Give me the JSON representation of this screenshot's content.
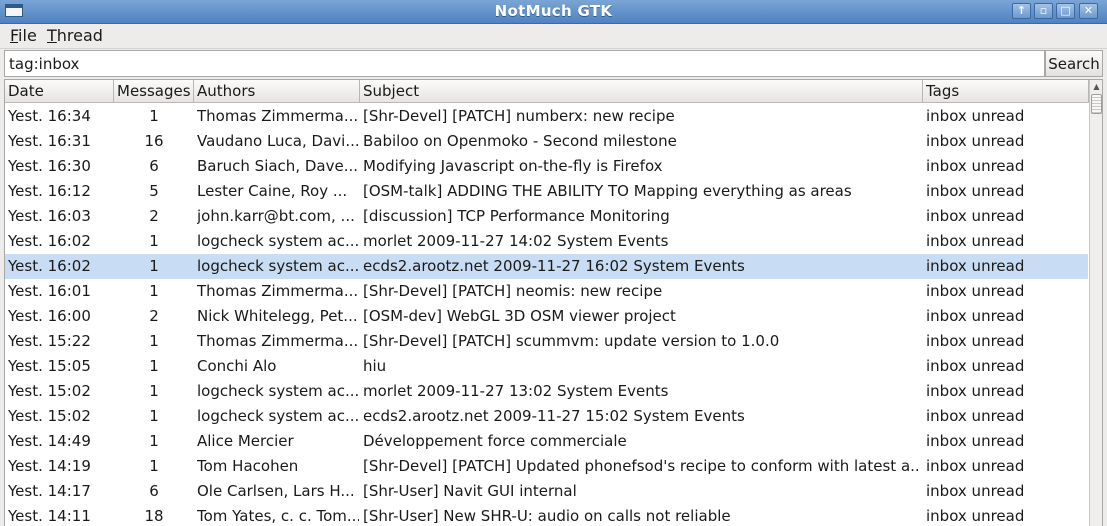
{
  "window": {
    "title": "NotMuch GTK",
    "buttons": {
      "up": "↑",
      "minimize": "▫",
      "maximize": "□",
      "close": "✕"
    }
  },
  "menu": {
    "file_prefix": "F",
    "file_rest": "ile",
    "thread_prefix": "T",
    "thread_rest": "hread"
  },
  "search": {
    "value": "tag:inbox",
    "button_label": "Search"
  },
  "columns": {
    "date": "Date",
    "messages": "Messages",
    "authors": "Authors",
    "subject": "Subject",
    "tags": "Tags"
  },
  "scroll_up_glyph": "▲",
  "colors": {
    "selection": "#c8dcf3",
    "titlebar": "#5b8cc6"
  },
  "selected_row": 6,
  "rows": [
    {
      "date": "Yest. 16:34",
      "messages": "1",
      "authors": "Thomas Zimmerma...",
      "subject": "[Shr-Devel] [PATCH] numberx: new recipe",
      "tags": "inbox unread"
    },
    {
      "date": "Yest. 16:31",
      "messages": "16",
      "authors": "Vaudano Luca, Davi...",
      "subject": "Babiloo on Openmoko - Second milestone",
      "tags": "inbox unread"
    },
    {
      "date": "Yest. 16:30",
      "messages": "6",
      "authors": "Baruch Siach, Dave...",
      "subject": "Modifying Javascript on-the-fly is Firefox",
      "tags": "inbox unread"
    },
    {
      "date": "Yest. 16:12",
      "messages": "5",
      "authors": "Lester Caine, Roy ...",
      "subject": "[OSM-talk] ADDING THE ABILITY TO Mapping everything as areas",
      "tags": "inbox unread"
    },
    {
      "date": "Yest. 16:03",
      "messages": "2",
      "authors": "john.karr@bt.com, ...",
      "subject": "[discussion] TCP Performance Monitoring",
      "tags": "inbox unread"
    },
    {
      "date": "Yest. 16:02",
      "messages": "1",
      "authors": "logcheck system ac...",
      "subject": "morlet 2009-11-27 14:02 System Events",
      "tags": "inbox unread"
    },
    {
      "date": "Yest. 16:02",
      "messages": "1",
      "authors": "logcheck system ac...",
      "subject": "ecds2.arootz.net 2009-11-27 16:02 System Events",
      "tags": "inbox unread"
    },
    {
      "date": "Yest. 16:01",
      "messages": "1",
      "authors": "Thomas Zimmerma...",
      "subject": "[Shr-Devel] [PATCH] neomis: new recipe",
      "tags": "inbox unread"
    },
    {
      "date": "Yest. 16:00",
      "messages": "2",
      "authors": "Nick Whitelegg, Pet...",
      "subject": "[OSM-dev] WebGL 3D OSM viewer project",
      "tags": "inbox unread"
    },
    {
      "date": "Yest. 15:22",
      "messages": "1",
      "authors": "Thomas Zimmerma...",
      "subject": "[Shr-Devel] [PATCH] scummvm: update version to 1.0.0",
      "tags": "inbox unread"
    },
    {
      "date": "Yest. 15:05",
      "messages": "1",
      "authors": "Conchi Alo",
      "subject": "hiu",
      "tags": "inbox unread"
    },
    {
      "date": "Yest. 15:02",
      "messages": "1",
      "authors": "logcheck system ac...",
      "subject": "morlet 2009-11-27 13:02 System Events",
      "tags": "inbox unread"
    },
    {
      "date": "Yest. 15:02",
      "messages": "1",
      "authors": "logcheck system ac...",
      "subject": "ecds2.arootz.net 2009-11-27 15:02 System Events",
      "tags": "inbox unread"
    },
    {
      "date": "Yest. 14:49",
      "messages": "1",
      "authors": "Alice Mercier",
      "subject": "Développement  force commerciale",
      "tags": "inbox unread"
    },
    {
      "date": "Yest. 14:19",
      "messages": "1",
      "authors": "Tom Hacohen",
      "subject": "[Shr-Devel] [PATCH] Updated phonefsod's recipe to conform with latest a...",
      "tags": "inbox unread"
    },
    {
      "date": "Yest. 14:17",
      "messages": "6",
      "authors": "Ole Carlsen, Lars H...",
      "subject": "[Shr-User] Navit GUI internal",
      "tags": "inbox unread"
    },
    {
      "date": "Yest. 14:11",
      "messages": "18",
      "authors": "Tom Yates, c. c. Tom...",
      "subject": "[Shr-User] New SHR-U: audio on calls not reliable",
      "tags": "inbox unread"
    }
  ]
}
